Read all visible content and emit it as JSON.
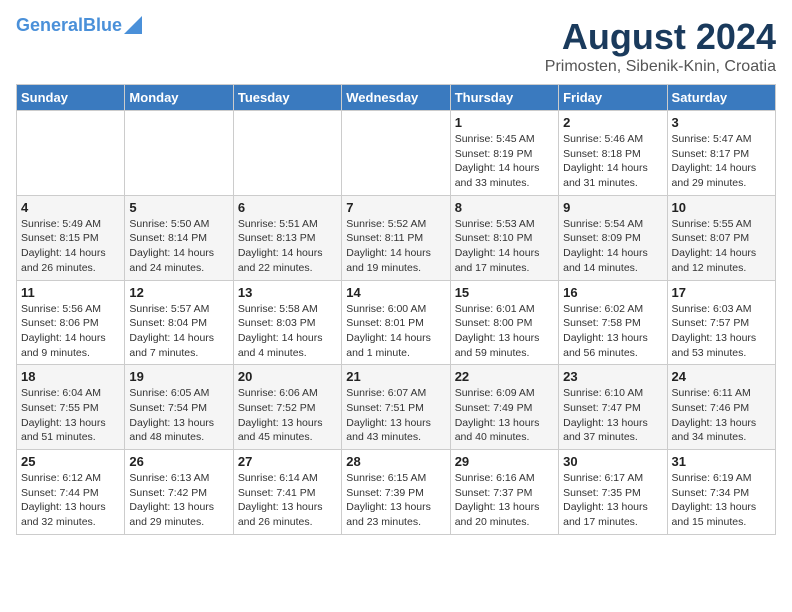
{
  "header": {
    "logo_line1": "General",
    "logo_line2": "Blue",
    "title": "August 2024",
    "subtitle": "Primosten, Sibenik-Knin, Croatia"
  },
  "weekdays": [
    "Sunday",
    "Monday",
    "Tuesday",
    "Wednesday",
    "Thursday",
    "Friday",
    "Saturday"
  ],
  "weeks": [
    [
      {
        "day": "",
        "info": ""
      },
      {
        "day": "",
        "info": ""
      },
      {
        "day": "",
        "info": ""
      },
      {
        "day": "",
        "info": ""
      },
      {
        "day": "1",
        "info": "Sunrise: 5:45 AM\nSunset: 8:19 PM\nDaylight: 14 hours\nand 33 minutes."
      },
      {
        "day": "2",
        "info": "Sunrise: 5:46 AM\nSunset: 8:18 PM\nDaylight: 14 hours\nand 31 minutes."
      },
      {
        "day": "3",
        "info": "Sunrise: 5:47 AM\nSunset: 8:17 PM\nDaylight: 14 hours\nand 29 minutes."
      }
    ],
    [
      {
        "day": "4",
        "info": "Sunrise: 5:49 AM\nSunset: 8:15 PM\nDaylight: 14 hours\nand 26 minutes."
      },
      {
        "day": "5",
        "info": "Sunrise: 5:50 AM\nSunset: 8:14 PM\nDaylight: 14 hours\nand 24 minutes."
      },
      {
        "day": "6",
        "info": "Sunrise: 5:51 AM\nSunset: 8:13 PM\nDaylight: 14 hours\nand 22 minutes."
      },
      {
        "day": "7",
        "info": "Sunrise: 5:52 AM\nSunset: 8:11 PM\nDaylight: 14 hours\nand 19 minutes."
      },
      {
        "day": "8",
        "info": "Sunrise: 5:53 AM\nSunset: 8:10 PM\nDaylight: 14 hours\nand 17 minutes."
      },
      {
        "day": "9",
        "info": "Sunrise: 5:54 AM\nSunset: 8:09 PM\nDaylight: 14 hours\nand 14 minutes."
      },
      {
        "day": "10",
        "info": "Sunrise: 5:55 AM\nSunset: 8:07 PM\nDaylight: 14 hours\nand 12 minutes."
      }
    ],
    [
      {
        "day": "11",
        "info": "Sunrise: 5:56 AM\nSunset: 8:06 PM\nDaylight: 14 hours\nand 9 minutes."
      },
      {
        "day": "12",
        "info": "Sunrise: 5:57 AM\nSunset: 8:04 PM\nDaylight: 14 hours\nand 7 minutes."
      },
      {
        "day": "13",
        "info": "Sunrise: 5:58 AM\nSunset: 8:03 PM\nDaylight: 14 hours\nand 4 minutes."
      },
      {
        "day": "14",
        "info": "Sunrise: 6:00 AM\nSunset: 8:01 PM\nDaylight: 14 hours\nand 1 minute."
      },
      {
        "day": "15",
        "info": "Sunrise: 6:01 AM\nSunset: 8:00 PM\nDaylight: 13 hours\nand 59 minutes."
      },
      {
        "day": "16",
        "info": "Sunrise: 6:02 AM\nSunset: 7:58 PM\nDaylight: 13 hours\nand 56 minutes."
      },
      {
        "day": "17",
        "info": "Sunrise: 6:03 AM\nSunset: 7:57 PM\nDaylight: 13 hours\nand 53 minutes."
      }
    ],
    [
      {
        "day": "18",
        "info": "Sunrise: 6:04 AM\nSunset: 7:55 PM\nDaylight: 13 hours\nand 51 minutes."
      },
      {
        "day": "19",
        "info": "Sunrise: 6:05 AM\nSunset: 7:54 PM\nDaylight: 13 hours\nand 48 minutes."
      },
      {
        "day": "20",
        "info": "Sunrise: 6:06 AM\nSunset: 7:52 PM\nDaylight: 13 hours\nand 45 minutes."
      },
      {
        "day": "21",
        "info": "Sunrise: 6:07 AM\nSunset: 7:51 PM\nDaylight: 13 hours\nand 43 minutes."
      },
      {
        "day": "22",
        "info": "Sunrise: 6:09 AM\nSunset: 7:49 PM\nDaylight: 13 hours\nand 40 minutes."
      },
      {
        "day": "23",
        "info": "Sunrise: 6:10 AM\nSunset: 7:47 PM\nDaylight: 13 hours\nand 37 minutes."
      },
      {
        "day": "24",
        "info": "Sunrise: 6:11 AM\nSunset: 7:46 PM\nDaylight: 13 hours\nand 34 minutes."
      }
    ],
    [
      {
        "day": "25",
        "info": "Sunrise: 6:12 AM\nSunset: 7:44 PM\nDaylight: 13 hours\nand 32 minutes."
      },
      {
        "day": "26",
        "info": "Sunrise: 6:13 AM\nSunset: 7:42 PM\nDaylight: 13 hours\nand 29 minutes."
      },
      {
        "day": "27",
        "info": "Sunrise: 6:14 AM\nSunset: 7:41 PM\nDaylight: 13 hours\nand 26 minutes."
      },
      {
        "day": "28",
        "info": "Sunrise: 6:15 AM\nSunset: 7:39 PM\nDaylight: 13 hours\nand 23 minutes."
      },
      {
        "day": "29",
        "info": "Sunrise: 6:16 AM\nSunset: 7:37 PM\nDaylight: 13 hours\nand 20 minutes."
      },
      {
        "day": "30",
        "info": "Sunrise: 6:17 AM\nSunset: 7:35 PM\nDaylight: 13 hours\nand 17 minutes."
      },
      {
        "day": "31",
        "info": "Sunrise: 6:19 AM\nSunset: 7:34 PM\nDaylight: 13 hours\nand 15 minutes."
      }
    ]
  ]
}
